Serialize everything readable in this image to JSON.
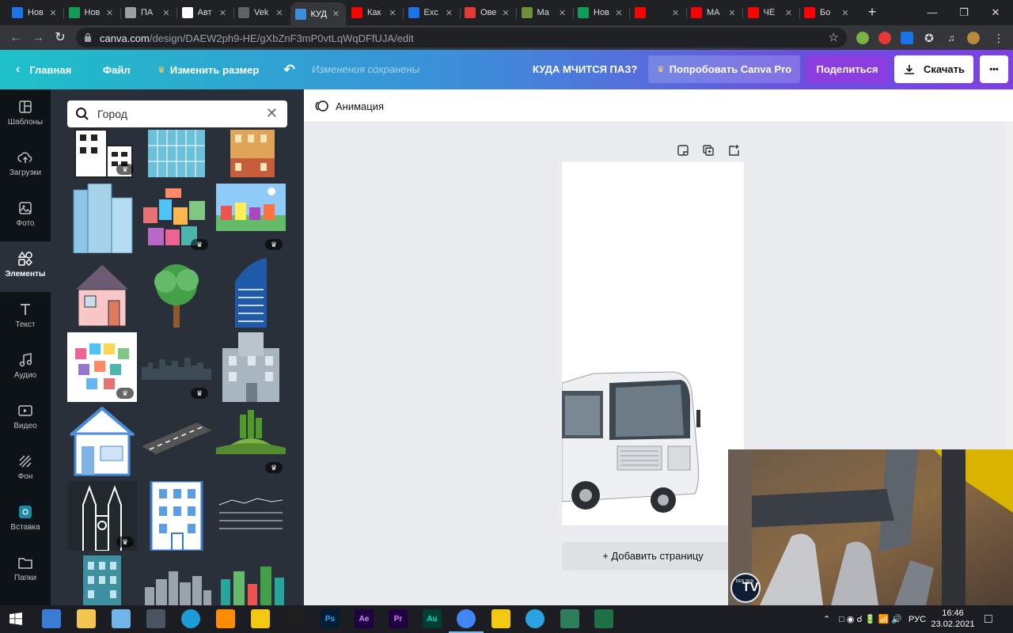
{
  "browser": {
    "tabs": [
      {
        "title": "Нов",
        "icon": "messenger-icon",
        "color": "#1a73e8"
      },
      {
        "title": "Нов",
        "icon": "sheets-icon",
        "color": "#0f9d58"
      },
      {
        "title": "ПА",
        "icon": "fitness-icon",
        "color": "#9aa0a6"
      },
      {
        "title": "Авт",
        "icon": "site-icon",
        "color": "#ffffff"
      },
      {
        "title": "Vek",
        "icon": "globe-icon",
        "color": "#5f6368"
      },
      {
        "title": "КУД",
        "icon": "canva-icon",
        "color": "#3b8fd8"
      },
      {
        "title": "Как",
        "icon": "youtube-icon",
        "color": "#ff0000"
      },
      {
        "title": "Exc",
        "icon": "feather-icon",
        "color": "#1a73e8"
      },
      {
        "title": "Ове",
        "icon": "adobe-icon",
        "color": "#e53935"
      },
      {
        "title": "Ма",
        "icon": "document-icon",
        "color": "#6f8f3a"
      },
      {
        "title": "Нов",
        "icon": "sheets-icon",
        "color": "#0f9d58"
      },
      {
        "title": "",
        "icon": "youtube-icon",
        "color": "#ff0000"
      },
      {
        "title": "МА",
        "icon": "youtube-icon",
        "color": "#ff0000"
      },
      {
        "title": "ЧЁ",
        "icon": "youtube-icon",
        "color": "#ff0000"
      },
      {
        "title": "Бо",
        "icon": "youtube-icon",
        "color": "#ff0000"
      }
    ],
    "active_tab": 5,
    "url_domain": "canva.com",
    "url_path": "/design/DAEW2ph9-HE/gXbZnF3mP0vtLqWqDFfUJA/edit"
  },
  "canva": {
    "home_label": "Главная",
    "file_label": "Файл",
    "resize_label": "Изменить размер",
    "saved_status": "Изменения сохранены",
    "design_title": "КУДА МЧИТСЯ ПАЗ?",
    "pro_label": "Попробовать Canva Pro",
    "share_label": "Поделиться",
    "download_label": "Скачать",
    "more_label": "•••",
    "animation_label": "Анимация",
    "add_page_label": "+ Добавить страницу",
    "accent_color": "#7d3fe3",
    "share_color": "#8b3ddf"
  },
  "rail": [
    {
      "label": "Шаблоны",
      "icon": "templates-icon"
    },
    {
      "label": "Загрузки",
      "icon": "upload-cloud-icon"
    },
    {
      "label": "Фото",
      "icon": "photo-icon"
    },
    {
      "label": "Элементы",
      "icon": "elements-icon"
    },
    {
      "label": "Текст",
      "icon": "text-icon"
    },
    {
      "label": "Аудио",
      "icon": "music-icon"
    },
    {
      "label": "Видео",
      "icon": "video-icon"
    },
    {
      "label": "Фон",
      "icon": "background-icon"
    },
    {
      "label": "Вставка",
      "icon": "embed-icon"
    },
    {
      "label": "Папки",
      "icon": "folder-icon"
    }
  ],
  "rail_active": 3,
  "search": {
    "value": "Город",
    "placeholder": ""
  },
  "thumbnails": [
    {
      "name": "office-building-outline",
      "pro": true
    },
    {
      "name": "glass-building",
      "pro": false
    },
    {
      "name": "apartment-block",
      "pro": false
    },
    {
      "name": "glass-tower",
      "pro": false
    },
    {
      "name": "colorful-houses",
      "pro": true
    },
    {
      "name": "cartoon-town",
      "pro": true
    },
    {
      "name": "pink-house",
      "pro": false
    },
    {
      "name": "green-tree",
      "pro": false
    },
    {
      "name": "blue-skyscraper",
      "pro": false
    },
    {
      "name": "houses-heart",
      "pro": true
    },
    {
      "name": "city-skyline-dark",
      "pro": true
    },
    {
      "name": "grey-building",
      "pro": false
    },
    {
      "name": "blue-house",
      "pro": false
    },
    {
      "name": "road",
      "pro": false
    },
    {
      "name": "green-hill-city",
      "pro": true
    },
    {
      "name": "cathedral",
      "pro": true
    },
    {
      "name": "blue-white-building",
      "pro": false
    },
    {
      "name": "sketch-city",
      "pro": false
    },
    {
      "name": "teal-building",
      "pro": false
    },
    {
      "name": "grey-skyline",
      "pro": false
    },
    {
      "name": "green-city",
      "pro": false
    }
  ],
  "video_overlay": {
    "logo_text": "TV",
    "logo_small": "DEN DEN"
  },
  "taskbar": {
    "lang": "РУС",
    "time": "16:46",
    "date": "23.02.2021",
    "apps": [
      {
        "label": "",
        "icon": "windows-icon"
      },
      {
        "label": "",
        "icon": "visual-studio-icon"
      },
      {
        "label": "",
        "icon": "file-explorer-icon"
      },
      {
        "label": "",
        "icon": "notepad-icon"
      },
      {
        "label": "",
        "icon": "calculator-icon"
      },
      {
        "label": "",
        "icon": "edge-icon"
      },
      {
        "label": "",
        "icon": "sublime-icon"
      },
      {
        "label": "",
        "icon": "power-bi-icon"
      },
      {
        "label": "",
        "icon": "figma-icon"
      },
      {
        "label": "Ps",
        "icon": "photoshop-icon"
      },
      {
        "label": "Ae",
        "icon": "after-effects-icon"
      },
      {
        "label": "Pr",
        "icon": "premiere-icon"
      },
      {
        "label": "Au",
        "icon": "audition-icon"
      },
      {
        "label": "",
        "icon": "chrome-icon"
      },
      {
        "label": "",
        "icon": "far-manager-icon"
      },
      {
        "label": "",
        "icon": "telegram-icon"
      },
      {
        "label": "",
        "icon": "app-icon"
      },
      {
        "label": "",
        "icon": "excel-icon"
      }
    ]
  }
}
